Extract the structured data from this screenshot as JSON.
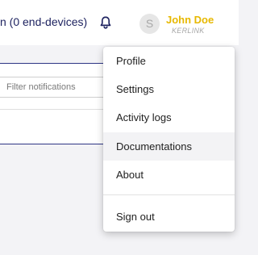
{
  "header": {
    "title": "n (0 end-devices)",
    "user": {
      "initial": "S",
      "name": "John Doe",
      "org": "KERLINK"
    }
  },
  "notifications": {
    "filter_placeholder": "Filter notifications"
  },
  "user_menu": {
    "items": [
      {
        "label": "Profile"
      },
      {
        "label": "Settings"
      },
      {
        "label": "Activity logs"
      },
      {
        "label": "Documentations"
      },
      {
        "label": "About"
      }
    ],
    "signout_label": "Sign out"
  },
  "icons": {
    "notifications": "bell-icon"
  },
  "colors": {
    "title": "#1f2461",
    "user_name": "#e7b800",
    "panel_border": "#2e3585"
  }
}
